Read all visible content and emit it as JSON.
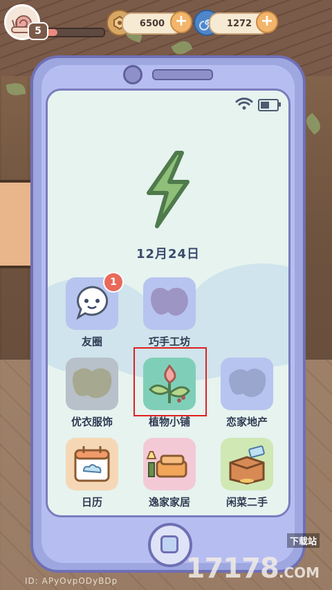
{
  "hud": {
    "level": "5",
    "xp_progress": 0.22,
    "currency_wood": "6500",
    "currency_swirl": "1272"
  },
  "phone": {
    "date": "12月24日",
    "apps": [
      {
        "label": "友圈",
        "badge": "1",
        "locked": false,
        "icon": "chat-bubble-icon"
      },
      {
        "label": "巧手工坊",
        "locked": true,
        "icon": "locked-silhouette-icon"
      },
      {
        "label": "优衣服饰",
        "locked": true,
        "icon": "locked-silhouette-icon"
      },
      {
        "label": "植物小铺",
        "locked": false,
        "icon": "sprout-icon",
        "highlighted": true
      },
      {
        "label": "恋家地产",
        "locked": true,
        "icon": "locked-silhouette-icon"
      },
      {
        "label": "日历",
        "locked": false,
        "icon": "calendar-icon"
      },
      {
        "label": "逸家家居",
        "locked": false,
        "icon": "sofa-icon"
      },
      {
        "label": "闲菜二手",
        "locked": false,
        "icon": "box-icon"
      }
    ]
  },
  "footer": {
    "user_id": "ID: APyOvpODyBDp",
    "watermark_num": "17178",
    "watermark_com": ".COM",
    "watermark_dl": "下载站"
  },
  "colors": {
    "highlight": "#e01f1f",
    "badge": "#e86a5b",
    "phone_body": "#9ea7e0"
  }
}
